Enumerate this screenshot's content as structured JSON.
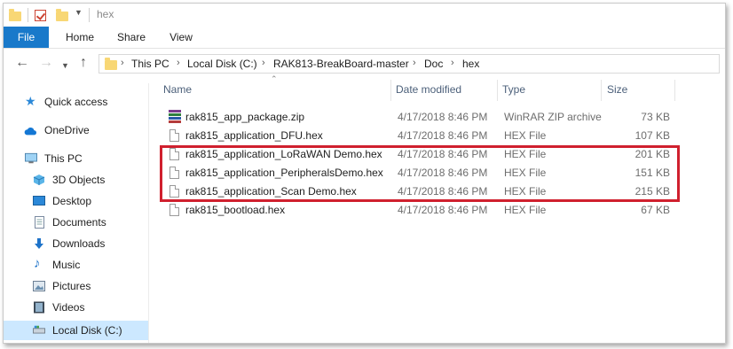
{
  "window": {
    "title": "hex"
  },
  "ribbon": {
    "tabs": [
      "File",
      "Home",
      "Share",
      "View"
    ]
  },
  "address": {
    "crumbs": [
      "This PC",
      "Local Disk (C:)",
      "RAK813-BreakBoard-master",
      "Doc",
      "hex"
    ]
  },
  "navpane": {
    "items": [
      {
        "label": "Quick access",
        "icon": "star-icon"
      },
      {
        "label": "OneDrive",
        "icon": "cloud-icon"
      },
      {
        "label": "This PC",
        "icon": "computer-icon"
      },
      {
        "label": "3D Objects",
        "icon": "cube-icon"
      },
      {
        "label": "Desktop",
        "icon": "desktop-icon"
      },
      {
        "label": "Documents",
        "icon": "documents-icon"
      },
      {
        "label": "Downloads",
        "icon": "download-icon"
      },
      {
        "label": "Music",
        "icon": "music-icon"
      },
      {
        "label": "Pictures",
        "icon": "pictures-icon"
      },
      {
        "label": "Videos",
        "icon": "videos-icon"
      },
      {
        "label": "Local Disk (C:)",
        "icon": "drive-icon",
        "selected": true
      }
    ]
  },
  "columns": {
    "name": "Name",
    "date": "Date modified",
    "type": "Type",
    "size": "Size"
  },
  "files": [
    {
      "name": "rak815_app_package.zip",
      "date": "4/17/2018 8:46 PM",
      "type": "WinRAR ZIP archive",
      "size": "73 KB",
      "icon": "winrar-zip-icon"
    },
    {
      "name": "rak815_application_DFU.hex",
      "date": "4/17/2018 8:46 PM",
      "type": "HEX File",
      "size": "107 KB",
      "icon": "file-icon"
    },
    {
      "name": "rak815_application_LoRaWAN Demo.hex",
      "date": "4/17/2018 8:46 PM",
      "type": "HEX File",
      "size": "201 KB",
      "icon": "file-icon"
    },
    {
      "name": "rak815_application_PeripheralsDemo.hex",
      "date": "4/17/2018 8:46 PM",
      "type": "HEX File",
      "size": "151 KB",
      "icon": "file-icon"
    },
    {
      "name": "rak815_application_Scan Demo.hex",
      "date": "4/17/2018 8:46 PM",
      "type": "HEX File",
      "size": "215 KB",
      "icon": "file-icon"
    },
    {
      "name": "rak815_bootload.hex",
      "date": "4/17/2018 8:46 PM",
      "type": "HEX File",
      "size": "67 KB",
      "icon": "file-icon"
    }
  ],
  "colors": {
    "accent": "#1979ca",
    "highlight_box": "#d0202e",
    "selection": "#cce8ff",
    "column_header": "#4c607a"
  }
}
